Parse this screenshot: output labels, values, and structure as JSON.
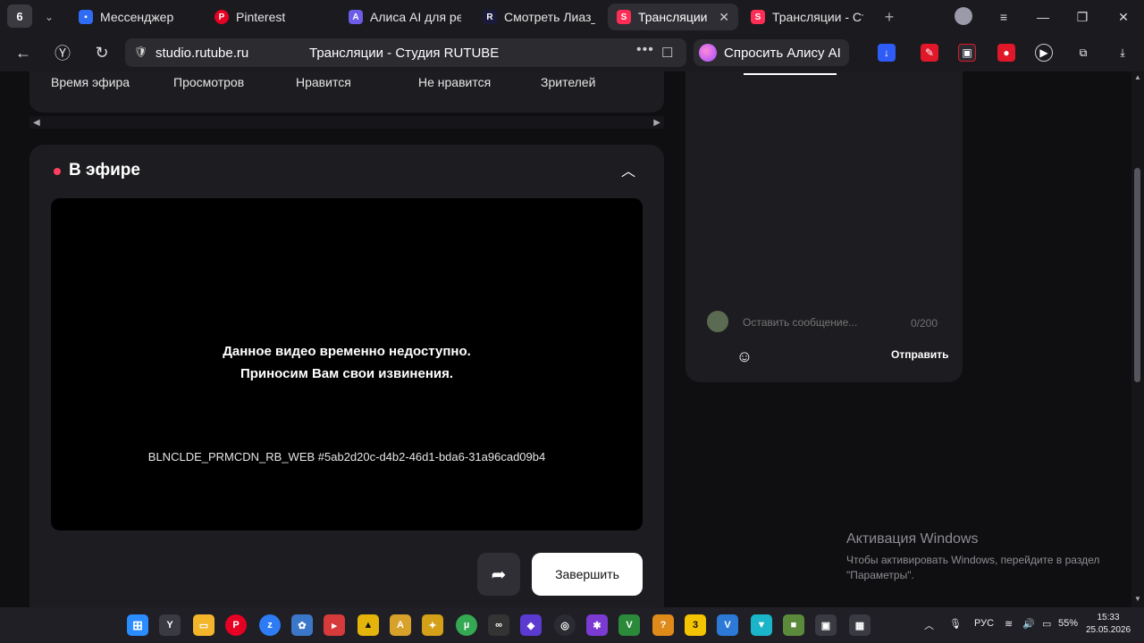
{
  "browser": {
    "tab_count": "6",
    "tabs": [
      {
        "label": "Мессенджер",
        "favicon": "messenger-icon",
        "color": "#2f6cf6",
        "active": false
      },
      {
        "label": "Pinterest",
        "favicon": "pinterest-icon",
        "color": "#e60023",
        "active": false
      },
      {
        "label": "Алиса AI для реш",
        "favicon": "alisa-icon",
        "color": "#6c5ce7",
        "active": false
      },
      {
        "label": "Смотреть Лиаз_I",
        "favicon": "rutube-r-icon",
        "color": "#1a1a3a",
        "active": false
      },
      {
        "label": "Трансляции - С",
        "favicon": "rutube-studio-icon",
        "color": "#ff2d55",
        "active": true
      },
      {
        "label": "Трансляции - Сту",
        "favicon": "rutube-studio-icon",
        "color": "#ff2d55",
        "active": false
      }
    ],
    "address": {
      "domain": "studio.rutube.ru",
      "title": "Трансляции - Студия RUTUBE"
    },
    "alisa_button": "Спросить Алису AI"
  },
  "stats": {
    "headers": [
      "Время эфира",
      "Просмотров",
      "Нравится",
      "Не нравится",
      "Зрителей"
    ]
  },
  "live": {
    "title": "В эфире",
    "status_color": "#ff3f62",
    "player": {
      "message_line1": "Данное видео временно недоступно.",
      "message_line2": "Приносим Вам свои извинения.",
      "error_code": "BLNCLDE_PRMCDN_RB_WEB #5ab2d20c-d4b2-46d1-bda6-31a96cad09b4"
    },
    "finish_button": "Завершить"
  },
  "chat": {
    "input_placeholder": "Оставить сообщение...",
    "counter": "0/200",
    "send_button": "Отправить"
  },
  "windows_activation": {
    "title": "Активация Windows",
    "subtitle": "Чтобы активировать Windows, перейдите в раздел \"Параметры\"."
  },
  "taskbar": {
    "language": "РУС",
    "battery": "55%",
    "time": "15:33",
    "date": "25.05.2026"
  }
}
